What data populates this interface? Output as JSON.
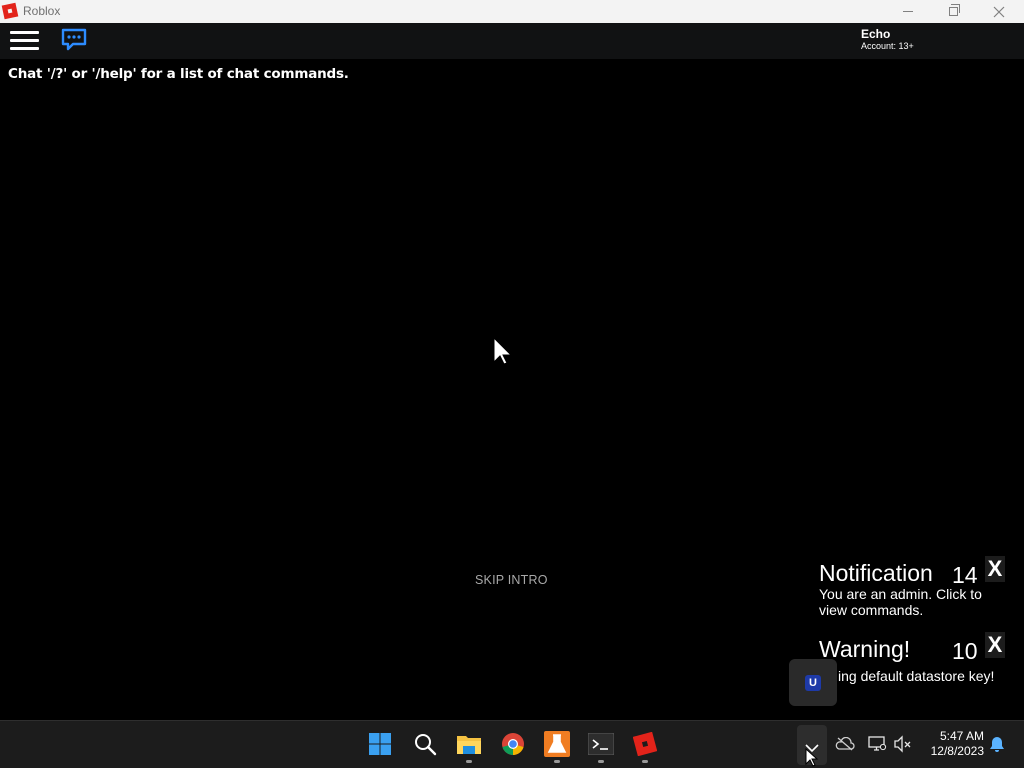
{
  "window": {
    "title": "Roblox"
  },
  "topbar": {
    "account_name": "Echo",
    "account_age": "Account: 13+"
  },
  "chat": {
    "help_text": "Chat '/?' or '/help' for a list of chat commands."
  },
  "intro": {
    "skip_label": "SKIP INTRO"
  },
  "notifications": [
    {
      "title": "Notification",
      "count": "14",
      "close": "X",
      "body": "You are an admin. Click to view commands."
    },
    {
      "title": "Warning!",
      "count": "10",
      "close": "X",
      "body": "ing default datastore key!"
    }
  ],
  "admin_logo": {
    "letter": "U"
  },
  "taskbar": {
    "apps": [
      "start-icon",
      "search-icon",
      "file-explorer-icon",
      "chrome-icon",
      "roblox-studio-icon",
      "terminal-icon",
      "roblox-icon"
    ],
    "clock_time": "5:47 AM",
    "clock_date": "12/8/2023"
  },
  "colors": {
    "roblox_red": "#e2231a",
    "chat_icon_blue": "#2d8cff",
    "taskbar_bg": "#1c1c1c"
  }
}
